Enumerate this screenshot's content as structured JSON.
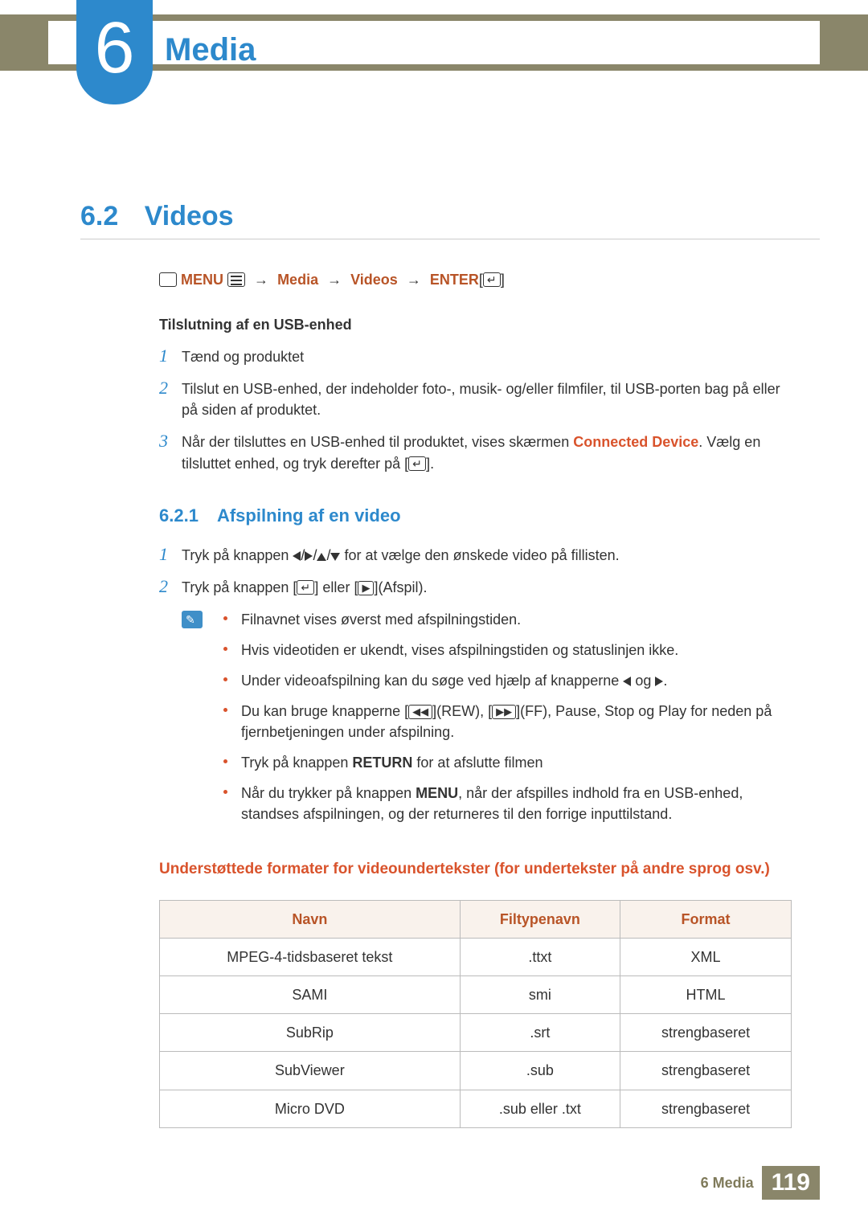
{
  "chapter": {
    "number": "6",
    "title": "Media"
  },
  "section": {
    "number": "6.2",
    "title": "Videos"
  },
  "nav": {
    "menu": "MENU",
    "sep": "→",
    "p1": "Media",
    "p2": "Videos",
    "enter": "ENTER"
  },
  "usb": {
    "heading": "Tilslutning af en USB-enhed",
    "s1": "Tænd og produktet",
    "s2": "Tilslut en USB-enhed, der indeholder foto-, musik- og/eller filmfiler, til USB-porten bag på eller på siden af produktet.",
    "s3a": "Når der tilsluttes en USB-enhed til produktet, vises skærmen ",
    "s3b": "Connected Device",
    "s3c": ". Vælg en tilsluttet enhed, og tryk derefter på [",
    "s3d": "]."
  },
  "subsec": {
    "number": "6.2.1",
    "title": "Afspilning af en video"
  },
  "play": {
    "s1a": "Tryk på knappen ",
    "s1b": " for at vælge den ønskede video på fillisten.",
    "s2a": "Tryk på knappen [",
    "s2b": "] eller [",
    "s2c": "](Afspil)."
  },
  "notes": {
    "b1": "Filnavnet vises øverst med afspilningstiden.",
    "b2": "Hvis videotiden er ukendt, vises afspilningstiden og statuslinjen ikke.",
    "b3a": "Under videoafspilning kan du søge ved hjælp af knapperne ",
    "b3b": " og ",
    "b3c": ".",
    "b4a": "Du kan bruge knapperne [",
    "b4b": "](REW), [",
    "b4c": "](FF), Pause, Stop og Play for neden på fjernbetjeningen under afspilning.",
    "b5a": "Tryk på knappen ",
    "b5b": "RETURN",
    "b5c": " for at afslutte filmen",
    "b6a": "Når du trykker på knappen ",
    "b6b": "MENU",
    "b6c": ", når der afspilles indhold fra en USB-enhed, standses afspilningen, og der returneres til den forrige inputtilstand."
  },
  "table": {
    "heading": "Understøttede formater for videoundertekster (for undertekster på andre sprog osv.)",
    "headers": {
      "c1": "Navn",
      "c2": "Filtypenavn",
      "c3": "Format"
    },
    "rows": [
      {
        "c1": "MPEG-4-tidsbaseret tekst",
        "c2": ".ttxt",
        "c3": "XML"
      },
      {
        "c1": "SAMI",
        "c2": "smi",
        "c3": "HTML"
      },
      {
        "c1": "SubRip",
        "c2": ".srt",
        "c3": "strengbaseret"
      },
      {
        "c1": "SubViewer",
        "c2": ".sub",
        "c3": "strengbaseret"
      },
      {
        "c1": "Micro DVD",
        "c2": ".sub eller .txt",
        "c3": "strengbaseret"
      }
    ]
  },
  "footer": {
    "label": "6 Media",
    "page": "119"
  },
  "btn": {
    "rew": "◀◀",
    "ff": "▶▶",
    "play": "▶"
  }
}
